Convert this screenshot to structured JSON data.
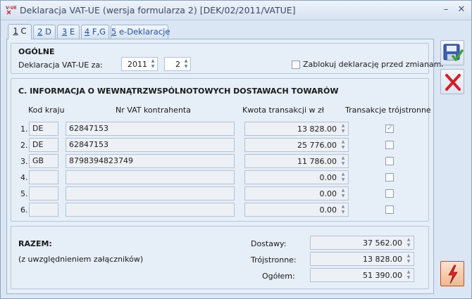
{
  "window": {
    "app_icon_text": "V-UE",
    "title": "Deklaracja VAT-UE (wersja formularza 2) [DEK/02/2011/VATUE]"
  },
  "tabs": [
    {
      "key": "1",
      "label": "C"
    },
    {
      "key": "2",
      "label": "D"
    },
    {
      "key": "3",
      "label": "E"
    },
    {
      "key": "4",
      "label": "F,G"
    },
    {
      "key": "5",
      "label": "e-Deklaracje"
    }
  ],
  "ogolne": {
    "title": "OGÓLNE",
    "label": "Deklaracja VAT-UE za:",
    "year": "2011",
    "month": "2",
    "lock_label": "Zablokuj deklarację przed zmianami",
    "lock_checked": false
  },
  "section_c": {
    "title": "C. INFORMACJA O WEWNĄTRZWSPÓLNOTOWYCH DOSTAWACH TOWARÓW",
    "headers": {
      "country": "Kod kraju",
      "vat": "Nr VAT kontrahenta",
      "amount": "Kwota transakcji w zł",
      "triangular": "Transakcje trójstronne"
    },
    "rows": [
      {
        "num": "1.",
        "country": "DE",
        "vat": "62847153",
        "amount": "13 828.00",
        "triangular": true
      },
      {
        "num": "2.",
        "country": "DE",
        "vat": "62847153",
        "amount": "25 776.00",
        "triangular": false
      },
      {
        "num": "3.",
        "country": "GB",
        "vat": "8798394823749",
        "amount": "11 786.00",
        "triangular": false
      },
      {
        "num": "4.",
        "country": "",
        "vat": "",
        "amount": "0.00",
        "triangular": false
      },
      {
        "num": "5.",
        "country": "",
        "vat": "",
        "amount": "0.00",
        "triangular": false
      },
      {
        "num": "6.",
        "country": "",
        "vat": "",
        "amount": "0.00",
        "triangular": false
      }
    ]
  },
  "razem": {
    "title": "RAZEM:",
    "subtitle": "(z uwzględnieniem załączników)",
    "dostawy_label": "Dostawy:",
    "dostawy_value": "37 562.00",
    "trojstronne_label": "Trójstronne:",
    "trojstronne_value": "13 828.00",
    "ogolem_label": "Ogółem:",
    "ogolem_value": "51 390.00"
  },
  "icons": {
    "save": "save-disk-icon",
    "cancel": "cancel-x-icon",
    "action": "lightning-icon"
  }
}
